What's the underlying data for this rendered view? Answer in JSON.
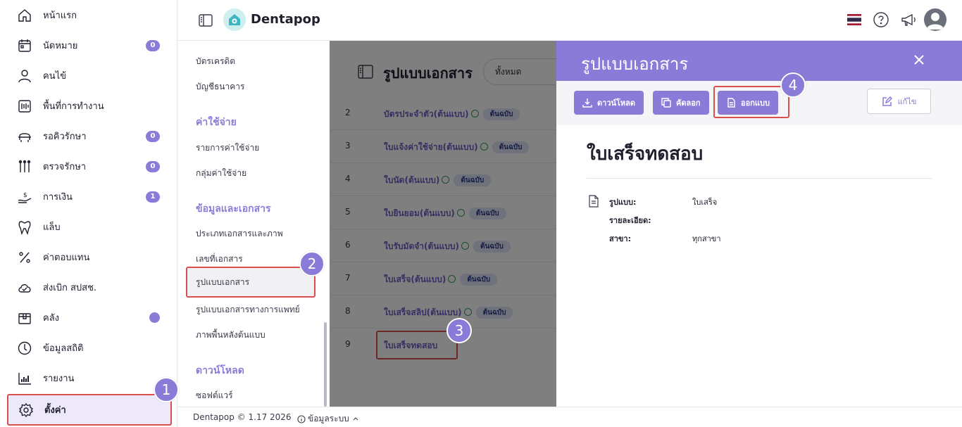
{
  "app": {
    "brand": "Dentapop"
  },
  "sidebar": {
    "items": [
      {
        "label": "หน้าแรก",
        "icon": "home-icon"
      },
      {
        "label": "นัดหมาย",
        "icon": "calendar-icon",
        "badge": "0"
      },
      {
        "label": "คนไข้",
        "icon": "user-icon"
      },
      {
        "label": "พื้นที่การทำงาน",
        "icon": "workspace-icon"
      },
      {
        "label": "รอคิวรักษา",
        "icon": "dental-chair-icon",
        "badge": "0"
      },
      {
        "label": "ตรวจรักษา",
        "icon": "dental-tools-icon",
        "badge": "0"
      },
      {
        "label": "การเงิน",
        "icon": "money-hand-icon",
        "badge": "1"
      },
      {
        "label": "แล็บ",
        "icon": "tooth-icon"
      },
      {
        "label": "ค่าตอบแทน",
        "icon": "percent-icon"
      },
      {
        "label": "ส่งเบิก สปสช.",
        "icon": "cloud-check-icon"
      },
      {
        "label": "คลัง",
        "icon": "box-icon",
        "dot": true
      },
      {
        "label": "ข้อมูลสถิติ",
        "icon": "clock-chart-icon"
      },
      {
        "label": "รายงาน",
        "icon": "bar-chart-icon"
      },
      {
        "label": "ตั้งค่า",
        "icon": "gear-icon",
        "active": true
      }
    ]
  },
  "submenu": {
    "items_top": [
      "บัตรเครดิต",
      "บัญชีธนาคาร"
    ],
    "section_expense": "ค่าใช้จ่าย",
    "items_expense": [
      "รายการค่าใช้จ่าย",
      "กลุ่มค่าใช้จ่าย"
    ],
    "section_docs": "ข้อมูลและเอกสาร",
    "items_docs": [
      "ประเภทเอกสารและภาพ",
      "เลขที่เอกสาร",
      "รูปแบบเอกสาร",
      "รูปแบบเอกสารทางการแพทย์",
      "ภาพพื้นหลังต้นแบบ"
    ],
    "section_download": "ดาวน์โหลด",
    "items_download": [
      "ซอฟต์แวร์"
    ]
  },
  "list": {
    "title": "รูปแบบเอกสาร",
    "filter_value": "ทั้งหมด",
    "tag": "ต้นฉบับ",
    "rows": [
      {
        "num": "2",
        "name": "บัตรประจำตัว(ต้นแบบ)",
        "original": true
      },
      {
        "num": "3",
        "name": "ใบแจ้งค่าใช้จ่าย(ต้นแบบ)",
        "original": true
      },
      {
        "num": "4",
        "name": "ใบนัด(ต้นแบบ)",
        "original": true
      },
      {
        "num": "5",
        "name": "ใบยินยอม(ต้นแบบ)",
        "original": true
      },
      {
        "num": "6",
        "name": "ใบรับมัดจำ(ต้นแบบ)",
        "original": true
      },
      {
        "num": "7",
        "name": "ใบเสร็จ(ต้นแบบ)",
        "original": true
      },
      {
        "num": "8",
        "name": "ใบเสร็จสลิป(ต้นแบบ)",
        "original": true
      },
      {
        "num": "9",
        "name": "ใบเสร็จทดสอบ",
        "original": false
      }
    ]
  },
  "drawer": {
    "title": "รูปแบบเอกสาร",
    "buttons": {
      "download": "ดาวน์โหลด",
      "copy": "คัดลอก",
      "design": "ออกแบบ",
      "edit": "แก้ไข"
    },
    "doc_title": "ใบเสร็จทดสอบ",
    "fields": [
      {
        "label": "รูปแบบ:",
        "value": "ใบเสร็จ"
      },
      {
        "label": "รายละเอียด:",
        "value": ""
      },
      {
        "label": "สาขา:",
        "value": "ทุกสาขา"
      }
    ]
  },
  "footer": {
    "version": "Dentapop © 1.17 2026",
    "system_info": "ข้อมูลระบบ"
  },
  "steps": [
    "1",
    "2",
    "3",
    "4"
  ],
  "colors": {
    "accent": "#8b7bd8",
    "highlight_border": "#d9504f",
    "tag_bg": "#dfe3f7"
  }
}
